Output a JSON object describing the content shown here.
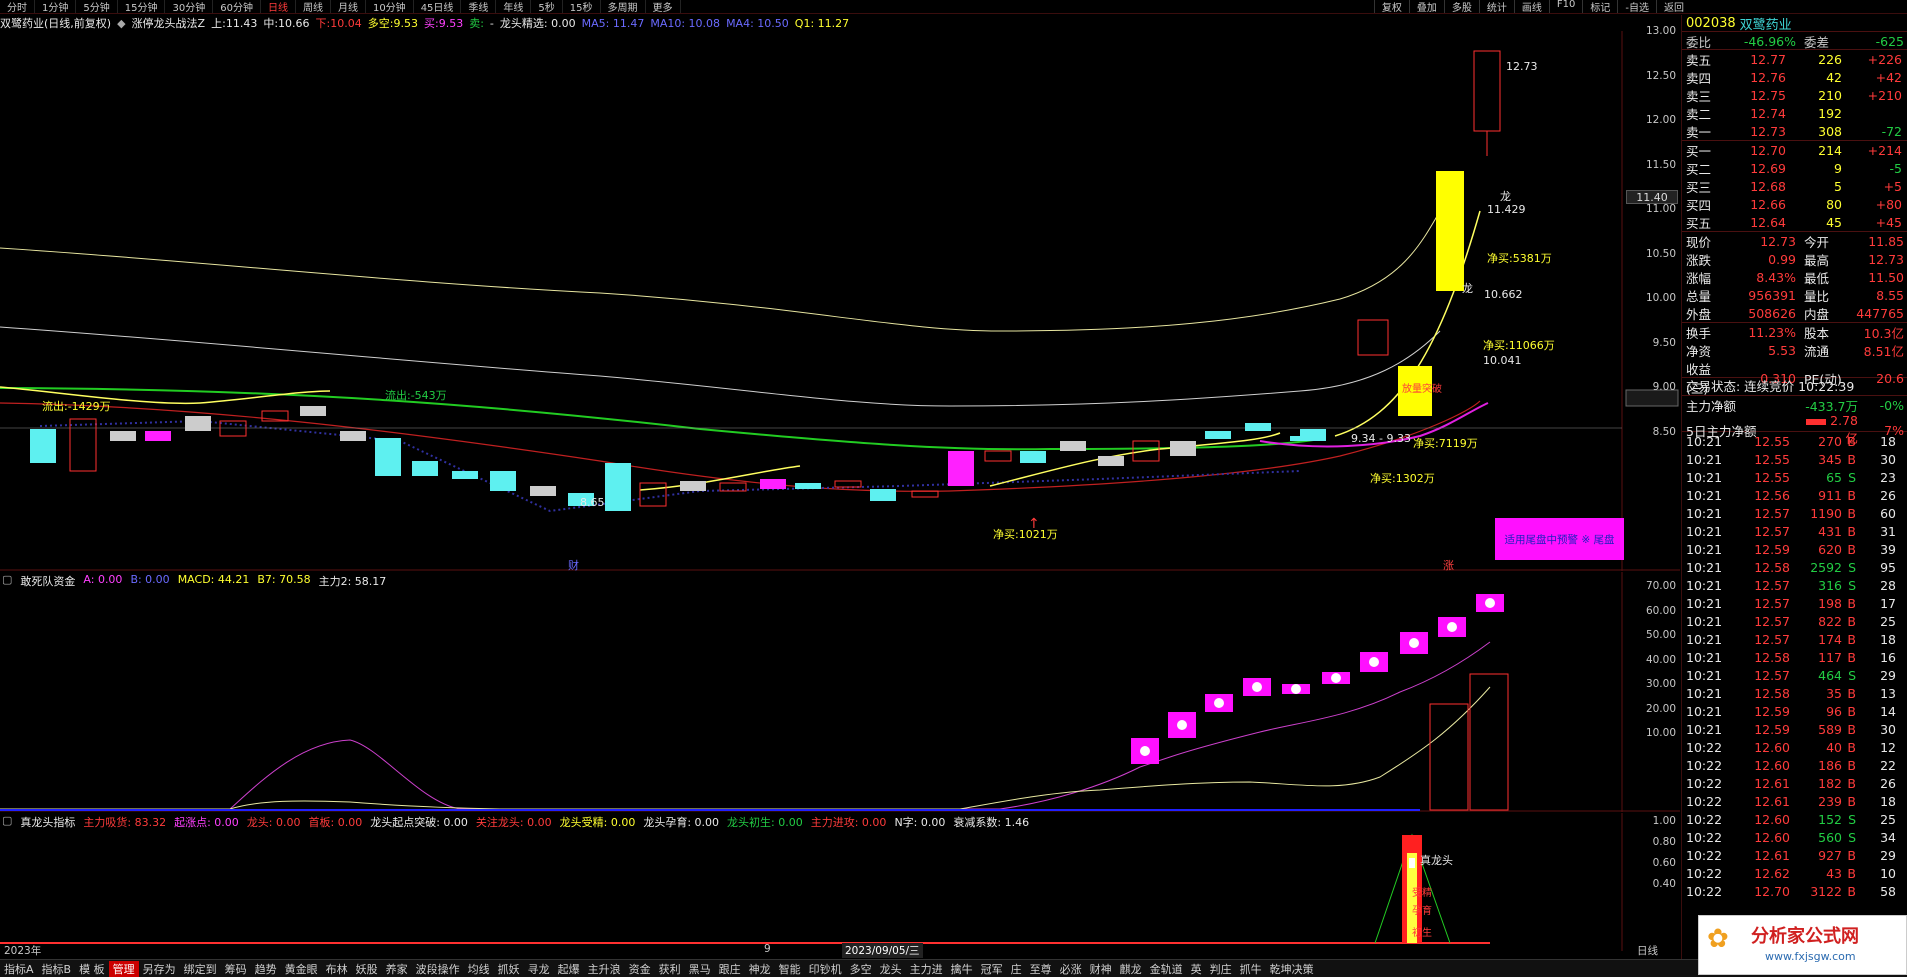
{
  "topbar": {
    "periods": [
      "分时",
      "1分钟",
      "5分钟",
      "15分钟",
      "30分钟",
      "60分钟",
      "日线",
      "周线",
      "月线",
      "10分钟",
      "45日线",
      "季线",
      "年线",
      "5秒",
      "15秒",
      "多周期",
      "更多"
    ],
    "active": "日线",
    "right": [
      "复权",
      "叠加",
      "多股",
      "统计",
      "画线",
      "F10",
      "标记",
      "-自选",
      "返回"
    ]
  },
  "title": {
    "stock": "双鹭药业(日线,前复权)",
    "indicator": "涨停龙头战法Z",
    "up_label": "上:",
    "up": "11.43",
    "mid_label": "中:",
    "mid": "10.66",
    "down_label": "下:",
    "down": "10.04",
    "dk_label": "多空:",
    "dk": "9.53",
    "buy_label": "买:",
    "buy": "9.53",
    "sell_label": "卖:",
    "lt_label": "龙头精选:",
    "lt": "0.00",
    "ma5": "MA5: 11.47",
    "ma10": "MA10: 10.08",
    "ma4": "MA4: 10.50",
    "q1": "Q1: 11.27"
  },
  "main_axis": [
    "13.00",
    "12.50",
    "12.00",
    "11.50",
    "11.00",
    "10.50",
    "10.00",
    "9.50",
    "9.00",
    "8.50"
  ],
  "crosshair_price": "11.40",
  "annotations": {
    "hi": "12.73",
    "long1": "龙",
    "p11429": "11.429",
    "nb5381": "净买:5381万",
    "long2": "龙",
    "p10662": "10.662",
    "nb11066": "净买:11066万",
    "p10041": "10.041",
    "volbreak": "放量突破",
    "range": "9.34 - 9.33",
    "nb7119": "净买:7119万",
    "nb1302": "净买:1302万",
    "nb1021": "净买:1021万",
    "out1429": "流出:-1429万",
    "out543": "流出:-543万",
    "low": "8.65",
    "cai": "财",
    "zhang": "涨",
    "promo": "适用尾盘中预警 ※ 尾盘"
  },
  "sub1": {
    "name": "敢死队资金",
    "a": "A: 0.00",
    "b": "B: 0.00",
    "macd": "MACD: 44.21",
    "b7": "B7: 70.58",
    "zl2": "主力2: 58.17",
    "axis": [
      "70.00",
      "60.00",
      "50.00",
      "40.00",
      "30.00",
      "20.00",
      "10.00"
    ]
  },
  "sub2": {
    "name": "真龙头指标",
    "items": [
      {
        "t": "主力吸货: 83.32",
        "c": "red"
      },
      {
        "t": "起涨点: 0.00",
        "c": "mag"
      },
      {
        "t": "龙头: 0.00",
        "c": "red"
      },
      {
        "t": "首板: 0.00",
        "c": "red"
      },
      {
        "t": "龙头起点突破: 0.00",
        "c": "wht"
      },
      {
        "t": "关注龙头: 0.00",
        "c": "red"
      },
      {
        "t": "龙头受精: 0.00",
        "c": "yel"
      },
      {
        "t": "龙头孕育: 0.00",
        "c": "wht"
      },
      {
        "t": "龙头初生: 0.00",
        "c": "grn"
      },
      {
        "t": "主力进攻: 0.00",
        "c": "red"
      },
      {
        "t": "N字: 0.00",
        "c": "wht"
      },
      {
        "t": "衰减系数: 1.46",
        "c": "wht"
      }
    ],
    "axis": [
      "1.00",
      "0.80",
      "0.60",
      "0.40"
    ],
    "zl": "真龙头",
    "l1": "受精",
    "l2": "孕育",
    "l3": "初生"
  },
  "xaxis": {
    "y2023": "2023年",
    "m9": "9",
    "date": "2023/09/05/三",
    "daily": "日线"
  },
  "bottombar": [
    "指标A",
    "指标B",
    "模 板",
    "管理",
    "另存为",
    "绑定到",
    "筹码",
    "趋势",
    "黄金眼",
    "布林",
    "妖股",
    "养家",
    "波段操作",
    "均线",
    "抓妖",
    "寻龙",
    "起爆",
    "主升浪",
    "资金",
    "获利",
    "黑马",
    "跟庄",
    "神龙",
    "智能",
    "印钞机",
    "多空",
    "龙头",
    "主力进",
    "擒牛",
    "冠军",
    "庄",
    "至尊",
    "必涨",
    "财神",
    "麒龙",
    "金轨道",
    "英",
    "判庄",
    "抓牛",
    "乾坤决策"
  ],
  "bottom_active": "管理",
  "rp": {
    "code": "002038",
    "name": "双鹭药业",
    "wb_label": "委比",
    "wb": "-46.96%",
    "wc_label": "委差",
    "wc": "-625",
    "asks": [
      [
        "卖五",
        "12.77",
        "226",
        "+226"
      ],
      [
        "卖四",
        "12.76",
        "42",
        "+42"
      ],
      [
        "卖三",
        "12.75",
        "210",
        "+210"
      ],
      [
        "卖二",
        "12.74",
        "192",
        ""
      ],
      [
        "卖一",
        "12.73",
        "308",
        "-72"
      ]
    ],
    "bids": [
      [
        "买一",
        "12.70",
        "214",
        "+214"
      ],
      [
        "买二",
        "12.69",
        "9",
        "-5"
      ],
      [
        "买三",
        "12.68",
        "5",
        "+5"
      ],
      [
        "买四",
        "12.66",
        "80",
        "+80"
      ],
      [
        "买五",
        "12.64",
        "45",
        "+45"
      ]
    ],
    "q1": [
      [
        "现价",
        "12.73",
        "今开",
        "11.85"
      ],
      [
        "涨跌",
        "0.99",
        "最高",
        "12.73"
      ],
      [
        "涨幅",
        "8.43%",
        "最低",
        "11.50"
      ],
      [
        "总量",
        "956391",
        "量比",
        "8.55"
      ],
      [
        "外盘",
        "508626",
        "内盘",
        "447765"
      ]
    ],
    "q2": [
      [
        "换手",
        "11.23%",
        "股本",
        "10.3亿"
      ],
      [
        "净资",
        "5.53",
        "流通",
        "8.51亿"
      ],
      [
        "收益(三)",
        "0.310",
        "PE(动)",
        "20.6"
      ]
    ],
    "status": "交易状态: 连续竞价 10:22:39",
    "zljr_label": "主力净额",
    "zljr": "-433.7万",
    "zljr_pct": "-0%",
    "d5_label": "5日主力净额",
    "d5": "2.78亿",
    "d5_pct": "7%",
    "ticks": [
      [
        "10:21",
        "12.55",
        "270",
        "B",
        "18"
      ],
      [
        "10:21",
        "12.55",
        "345",
        "B",
        "30"
      ],
      [
        "10:21",
        "12.55",
        "65",
        "S",
        "23"
      ],
      [
        "10:21",
        "12.56",
        "911",
        "B",
        "26"
      ],
      [
        "10:21",
        "12.57",
        "1190",
        "B",
        "60"
      ],
      [
        "10:21",
        "12.57",
        "431",
        "B",
        "31"
      ],
      [
        "10:21",
        "12.59",
        "620",
        "B",
        "39"
      ],
      [
        "10:21",
        "12.58",
        "2592",
        "S",
        "95"
      ],
      [
        "10:21",
        "12.57",
        "316",
        "S",
        "28"
      ],
      [
        "10:21",
        "12.57",
        "198",
        "B",
        "17"
      ],
      [
        "10:21",
        "12.57",
        "822",
        "B",
        "25"
      ],
      [
        "10:21",
        "12.57",
        "174",
        "B",
        "18"
      ],
      [
        "10:21",
        "12.58",
        "117",
        "B",
        "16"
      ],
      [
        "10:21",
        "12.57",
        "464",
        "S",
        "29"
      ],
      [
        "10:21",
        "12.58",
        "35",
        "B",
        "13"
      ],
      [
        "10:21",
        "12.59",
        "96",
        "B",
        "14"
      ],
      [
        "10:21",
        "12.59",
        "589",
        "B",
        "30"
      ],
      [
        "10:22",
        "12.60",
        "40",
        "B",
        "12"
      ],
      [
        "10:22",
        "12.60",
        "186",
        "B",
        "22"
      ],
      [
        "10:22",
        "12.61",
        "182",
        "B",
        "26"
      ],
      [
        "10:22",
        "12.61",
        "239",
        "B",
        "18"
      ],
      [
        "10:22",
        "12.60",
        "152",
        "S",
        "25"
      ],
      [
        "10:22",
        "12.60",
        "560",
        "S",
        "34"
      ],
      [
        "10:22",
        "12.61",
        "927",
        "B",
        "29"
      ],
      [
        "10:22",
        "12.62",
        "43",
        "B",
        "10"
      ],
      [
        "10:22",
        "12.70",
        "3122",
        "B",
        "58"
      ]
    ]
  },
  "logo": {
    "text": "分析家公式网",
    "url": "www.fxjsgw.com"
  }
}
